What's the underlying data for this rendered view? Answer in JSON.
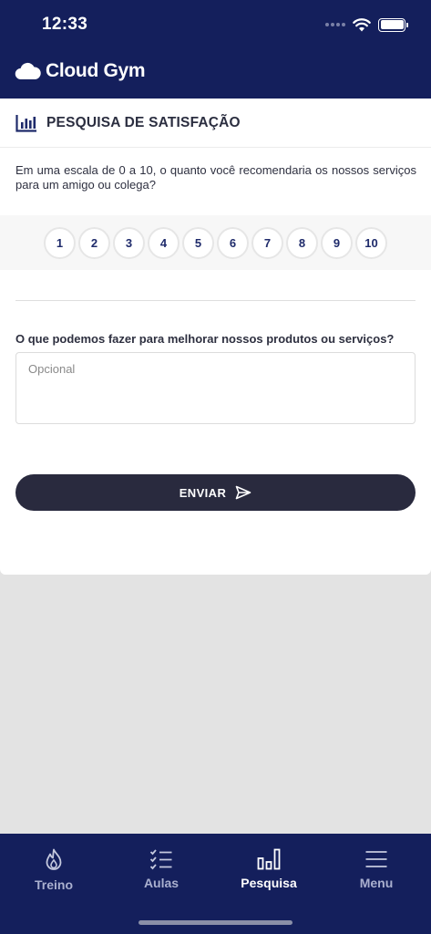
{
  "status_bar": {
    "time": "12:33"
  },
  "header": {
    "brand": "Cloud Gym"
  },
  "survey": {
    "title": "PESQUISA DE SATISFAÇÃO",
    "question_nps": "Em uma escala de 0 a 10, o quanto você recomendaria os nossos serviços para um amigo ou colega?",
    "scale": [
      "1",
      "2",
      "3",
      "4",
      "5",
      "6",
      "7",
      "8",
      "9",
      "10"
    ],
    "question_feedback": "O que podemos fazer para melhorar nossos produtos ou serviços?",
    "feedback_placeholder": "Opcional",
    "feedback_value": "",
    "submit_label": "ENVIAR"
  },
  "bottom_nav": {
    "items": [
      {
        "label": "Treino",
        "icon": "flame-icon"
      },
      {
        "label": "Aulas",
        "icon": "checklist-icon"
      },
      {
        "label": "Pesquisa",
        "icon": "bar-chart-icon",
        "active": true
      },
      {
        "label": "Menu",
        "icon": "hamburger-menu-icon"
      }
    ]
  },
  "colors": {
    "header_bg": "#141f5c",
    "button_bg": "#292a3e",
    "scale_number": "#1f2b6b"
  }
}
